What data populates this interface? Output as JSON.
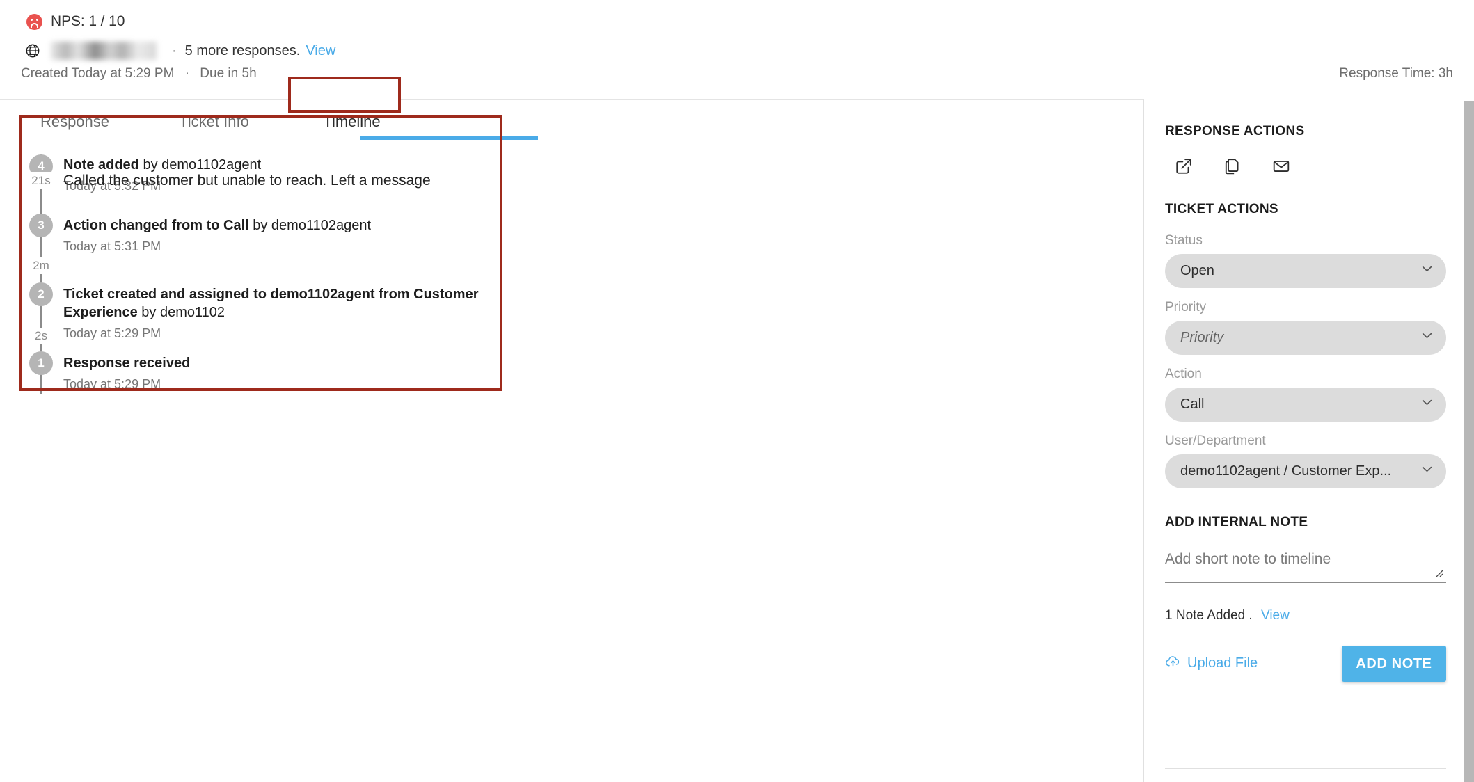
{
  "header": {
    "nps_label": "NPS: 1 / 10",
    "nps_icon": "sad-face-icon",
    "globe_icon": "globe-icon",
    "separator": "·",
    "more_responses": "5 more responses.",
    "view_link": "View",
    "created": "Created Today at 5:29 PM",
    "meta_separator": "·",
    "due": "Due in 5h",
    "response_time": "Response Time: 3h"
  },
  "tabs": [
    {
      "label": "Response",
      "active": false
    },
    {
      "label": "Ticket Info",
      "active": false
    },
    {
      "label": "Timeline",
      "active": true
    }
  ],
  "timeline": [
    {
      "num": "4",
      "title_bold": "Note added",
      "title_plain": " by demo1102agent",
      "time": "Today at 5:32 PM",
      "gap_below": "21s"
    },
    {
      "num": "",
      "note": "Called the customer but unable to reach. Left a message"
    },
    {
      "num": "3",
      "title_bold": "Action changed from to Call",
      "title_plain": " by demo1102agent",
      "time": "Today at 5:31 PM",
      "gap_below": "2m"
    },
    {
      "num": "2",
      "title_bold": "Ticket created and assigned to demo1102agent from Customer Experience",
      "title_plain": " by demo1102",
      "time": "Today at 5:29 PM",
      "gap_below": "2s"
    },
    {
      "num": "1",
      "title_bold": "Response received",
      "title_plain": "",
      "time": "Today at 5:29 PM",
      "gap_below": ""
    }
  ],
  "sidebar": {
    "response_actions_title": "RESPONSE ACTIONS",
    "action_icons": [
      {
        "name": "external-link-icon"
      },
      {
        "name": "copy-icon"
      },
      {
        "name": "envelope-icon"
      }
    ],
    "ticket_actions_title": "TICKET ACTIONS",
    "fields": [
      {
        "label": "Status",
        "value": "Open",
        "placeholder": false
      },
      {
        "label": "Priority",
        "value": "Priority",
        "placeholder": true
      },
      {
        "label": "Action",
        "value": "Call",
        "placeholder": false
      },
      {
        "label": "User/Department",
        "value": "demo1102agent / Customer Exp...",
        "placeholder": false
      }
    ],
    "add_note_title": "ADD INTERNAL NOTE",
    "note_placeholder": "Add short note to timeline",
    "note_value": "",
    "notes_added": "1 Note Added .",
    "notes_view_link": "View",
    "upload_label": "Upload File",
    "upload_icon": "cloud-upload-icon",
    "add_note_button": "ADD NOTE"
  },
  "colors": {
    "accent_blue": "#4aabe8",
    "annotation_red": "#9e2a1c",
    "node_gray": "#b5b5b5",
    "nps_red": "#e9524f"
  }
}
